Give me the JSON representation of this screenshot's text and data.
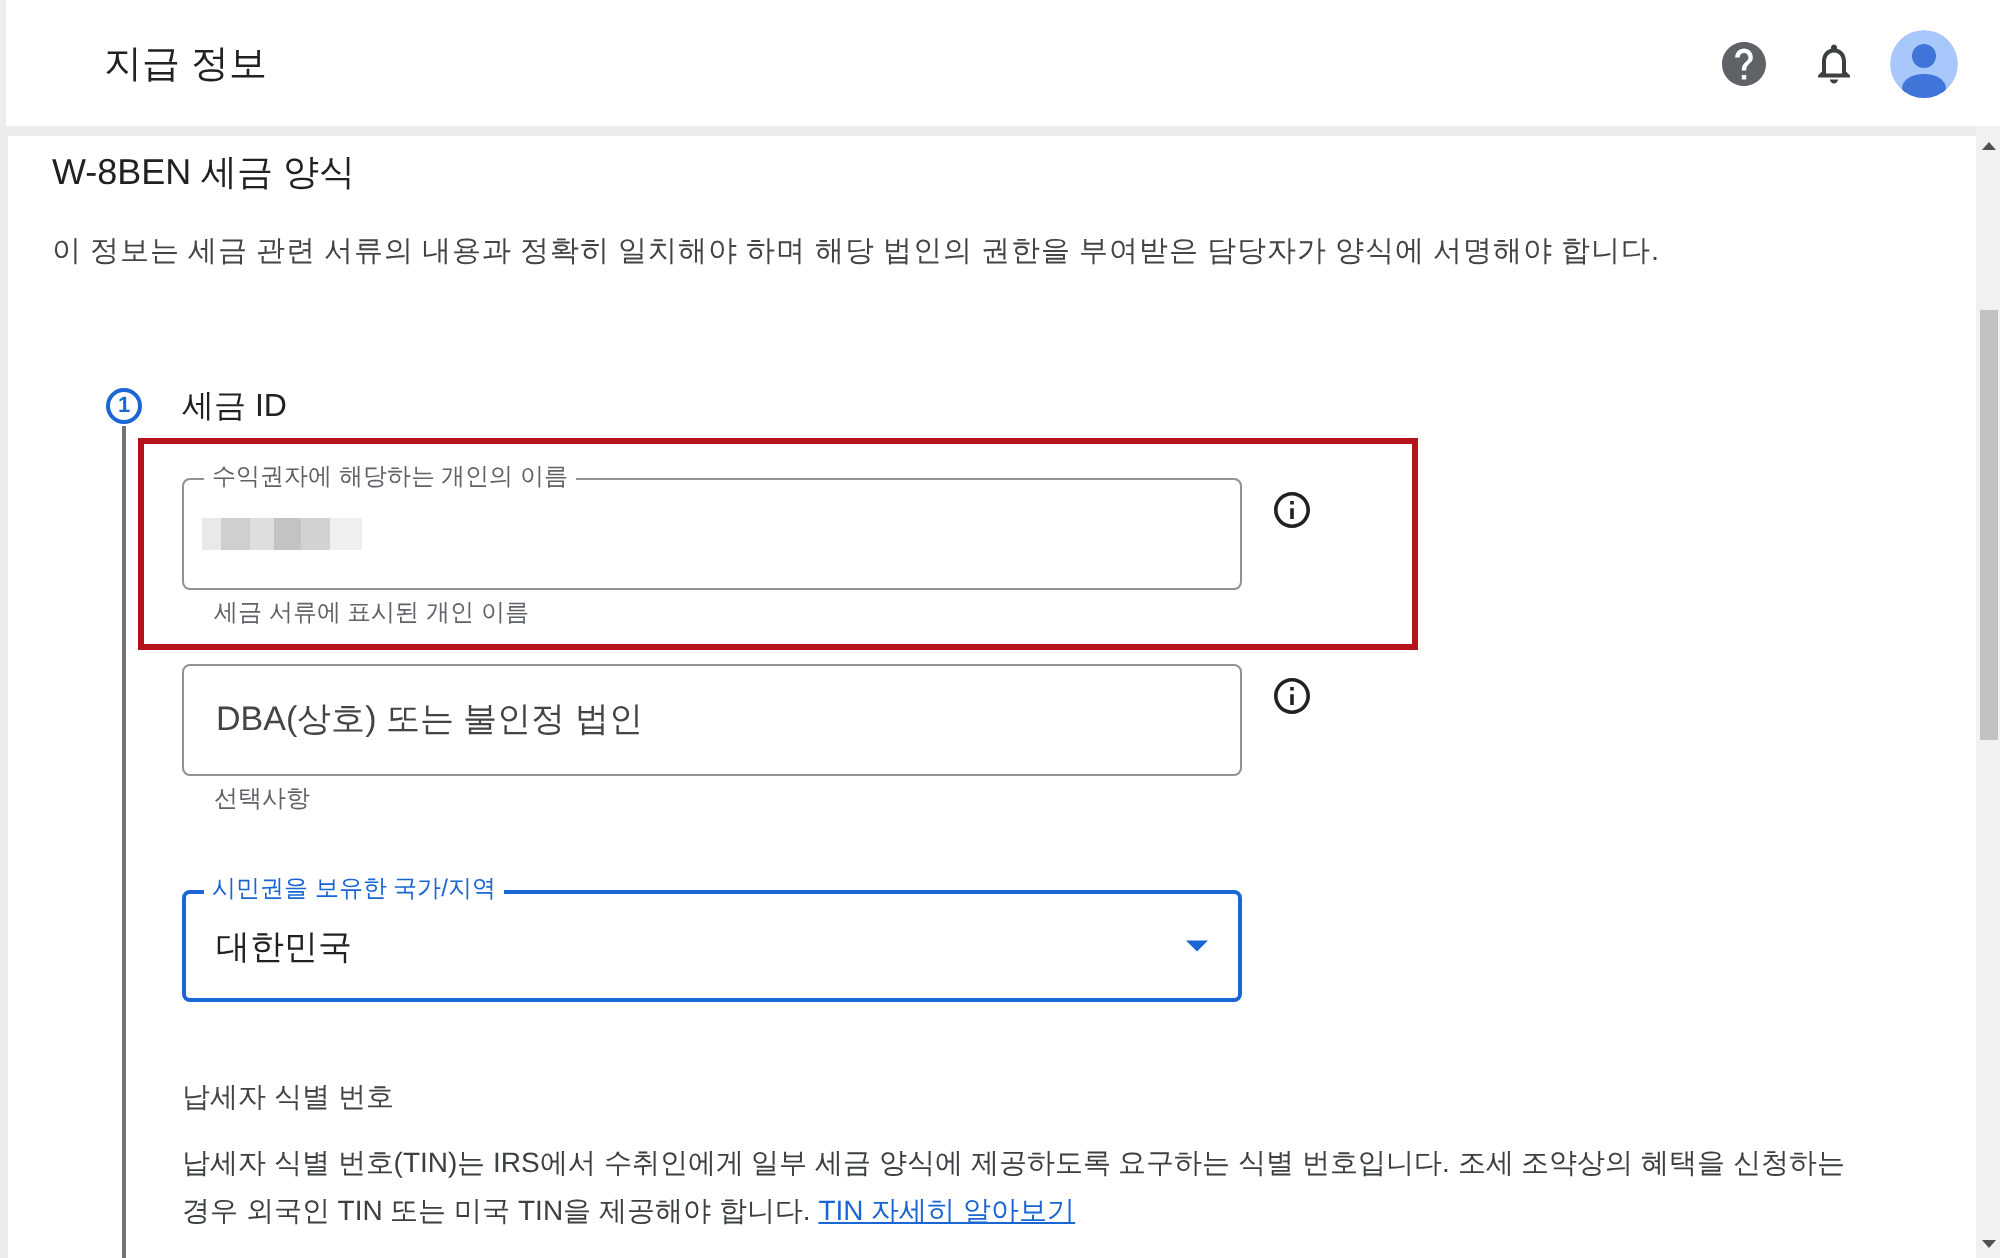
{
  "header": {
    "title": "지급 정보"
  },
  "form": {
    "title": "W-8BEN 세금 양식",
    "description": "이 정보는 세금 관련 서류의 내용과 정확히 일치해야 하며 해당 법인의 권한을 부여받은 담당자가 양식에 서명해야 합니다."
  },
  "steps": [
    {
      "number": "1",
      "title": "세금 ID",
      "fields": [
        {
          "kind": "text",
          "label": "수익권자에 해당하는 개인의 이름",
          "redacted": true,
          "hint": "세금 서류에 표시된 개인 이름",
          "info": true,
          "highlighted": true,
          "focused": false
        },
        {
          "kind": "text",
          "placeholder": "DBA(상호) 또는 불인정 법인",
          "hint": "선택사항",
          "info": true,
          "highlighted": false,
          "focused": false
        },
        {
          "kind": "select",
          "label": "시민권을 보유한 국가/지역",
          "value": "대한민국",
          "info": false,
          "highlighted": false,
          "focused": true
        }
      ],
      "sections": [
        {
          "heading": "납세자 식별 번호",
          "text": "납세자 식별 번호(TIN)는 IRS에서 수취인에게 일부 세금 양식에 제공하도록 요구하는 식별 번호입니다. 조세 조약상의 혜택을 신청하는 경우 외국인 TIN 또는 미국 TIN을 제공해야 합니다.",
          "link": "TIN 자세히 알아보기"
        }
      ]
    }
  ]
}
